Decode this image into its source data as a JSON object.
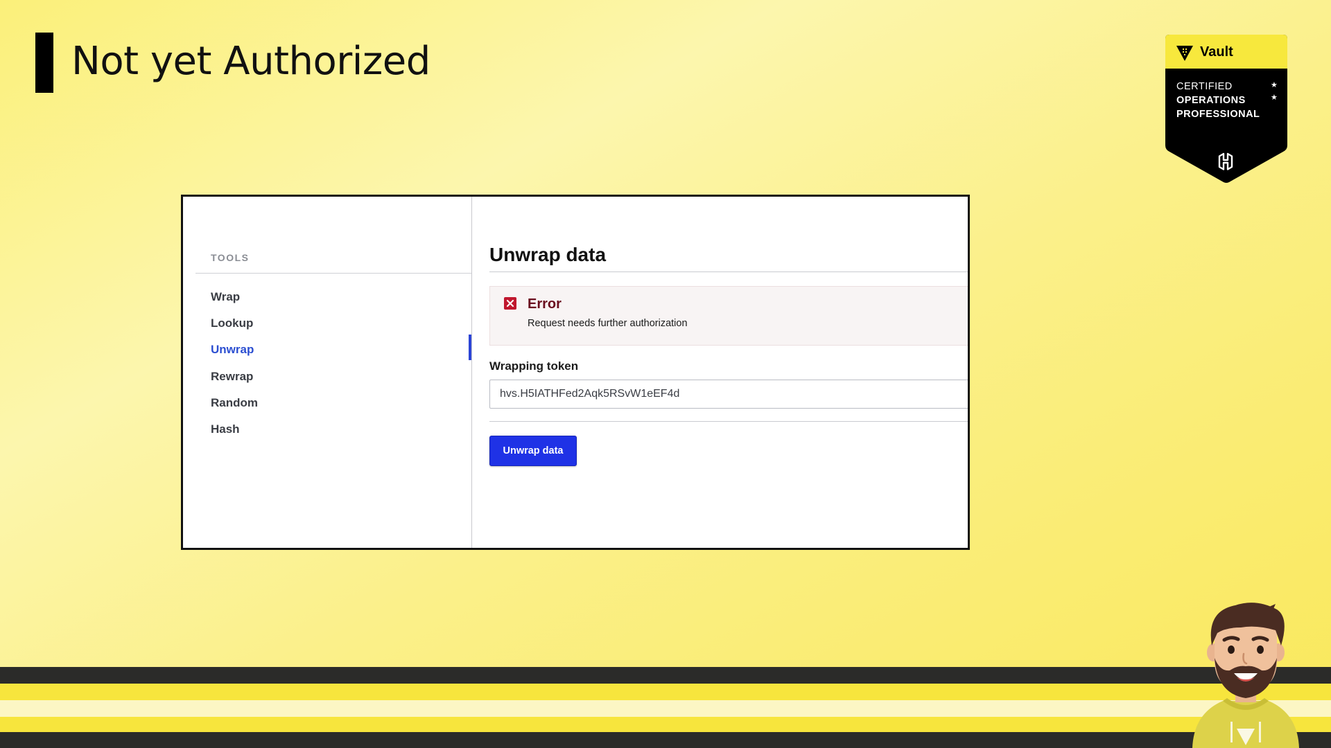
{
  "slide": {
    "title": "Not yet Authorized"
  },
  "badge": {
    "brand": "Vault",
    "line1": "CERTIFIED",
    "line2": "OPERATIONS",
    "line3": "PROFESSIONAL",
    "colors": {
      "top": "#f7e83d",
      "body": "#000000"
    }
  },
  "sidebar": {
    "heading": "TOOLS",
    "items": [
      {
        "label": "Wrap"
      },
      {
        "label": "Lookup"
      },
      {
        "label": "Unwrap",
        "active": true
      },
      {
        "label": "Rewrap"
      },
      {
        "label": "Random"
      },
      {
        "label": "Hash"
      }
    ]
  },
  "main": {
    "title": "Unwrap data",
    "error": {
      "title": "Error",
      "message": "Request needs further authorization"
    },
    "token_label": "Wrapping token",
    "token_value": "hvs.H5IATHFed2Aqk5RSvW1eEF4d",
    "button_label": "Unwrap data"
  },
  "colors": {
    "accent": "#1f32e6",
    "active_nav": "#2c4fd1",
    "error_text": "#6a0e1f",
    "error_icon": "#c0172e"
  }
}
